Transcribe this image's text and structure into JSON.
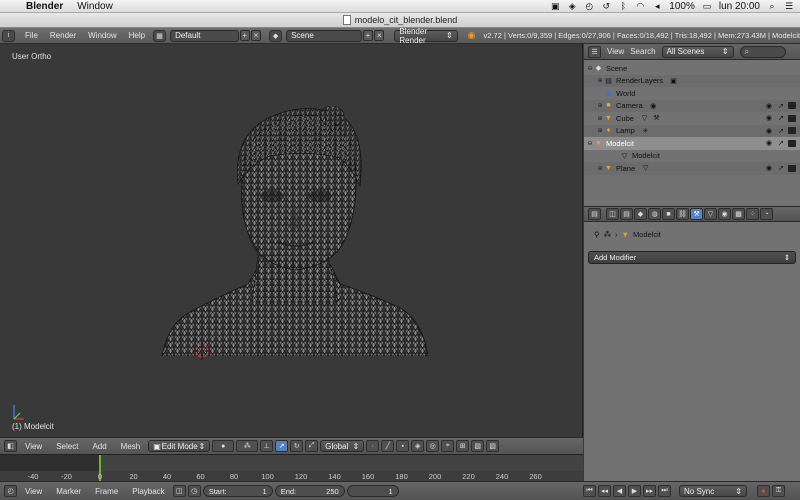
{
  "menubar": {
    "app_name": "Blender",
    "items": [
      "Window"
    ],
    "battery": "100%",
    "clock": "lun 20:00"
  },
  "window": {
    "title": "modelo_cit_blender.blend"
  },
  "info_header": {
    "menus": [
      "File",
      "Render",
      "Window",
      "Help"
    ],
    "screen_layout": "Default",
    "scene": "Scene",
    "render_engine": "Blender Render",
    "stats": "v2.72 | Verts:0/9,359 | Edges:0/27,906 | Faces:0/18,492 | Tris:18,492 | Mem:273.43M | Modelcit"
  },
  "viewport": {
    "view_label": "User Ortho",
    "object_label": "(1) Modelcit"
  },
  "view3d_header": {
    "menus": [
      "View",
      "Select",
      "Add",
      "Mesh"
    ],
    "mode": "Edit Mode",
    "orientation": "Global"
  },
  "timeline": {
    "ruler": [
      "-40",
      "-20",
      "0",
      "20",
      "40",
      "60",
      "80",
      "100",
      "120",
      "140",
      "160",
      "180",
      "200",
      "220",
      "240",
      "260"
    ],
    "current_frame_value": 0
  },
  "timeline_header": {
    "menus": [
      "View",
      "Marker",
      "Frame",
      "Playback"
    ],
    "start_label": "Start:",
    "start_value": "1",
    "end_label": "End:",
    "end_value": "250",
    "current_frame": "1",
    "sync": "No Sync"
  },
  "outliner_header": {
    "menus": [
      "View",
      "Search"
    ],
    "filter": "All Scenes"
  },
  "outliner": {
    "rows": [
      {
        "label": "Scene"
      },
      {
        "label": "RenderLayers"
      },
      {
        "label": "World"
      },
      {
        "label": "Camera"
      },
      {
        "label": "Cube"
      },
      {
        "label": "Lamp"
      },
      {
        "label": "Modelcit"
      },
      {
        "label": "Modelcit"
      },
      {
        "label": "Plane"
      }
    ]
  },
  "properties": {
    "breadcrumb_object": "Modelcit",
    "add_modifier": "Add Modifier"
  },
  "colors": {
    "accent": "#5680c2",
    "frame_marker": "#6fb33a",
    "viewport_bg": "#393939",
    "panel_bg": "#727272"
  }
}
